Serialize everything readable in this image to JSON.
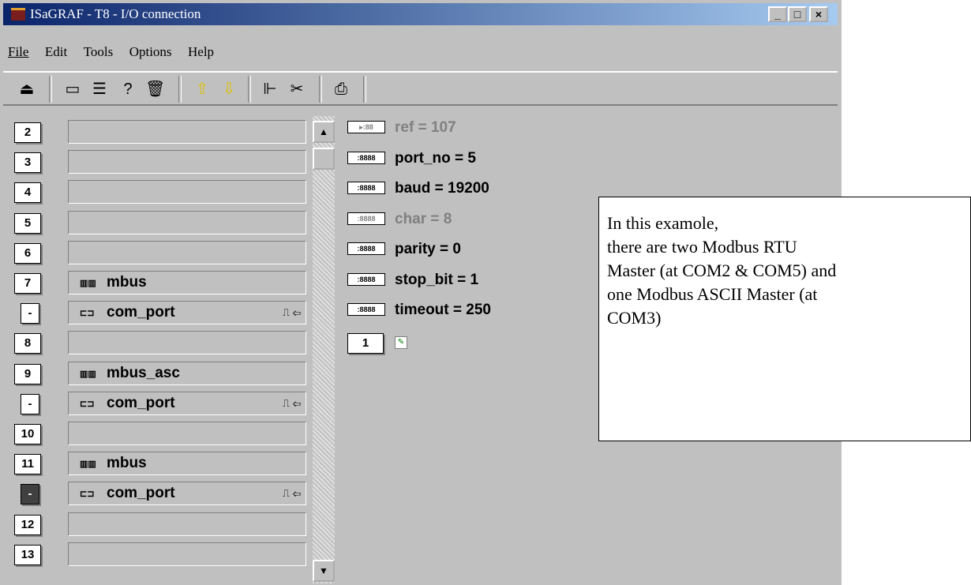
{
  "window": {
    "title": "ISaGRAF - T8 - I/O connection"
  },
  "menu": [
    "File",
    "Edit",
    "Tools",
    "Options",
    "Help"
  ],
  "slots": [
    {
      "num": "2",
      "label": ""
    },
    {
      "num": "3",
      "label": ""
    },
    {
      "num": "4",
      "label": ""
    },
    {
      "num": "5",
      "label": ""
    },
    {
      "num": "6",
      "label": ""
    },
    {
      "num": "7",
      "label": "mbus",
      "icon": "board-icon"
    },
    {
      "num": "-",
      "label": "com_port",
      "icon": "port-icon",
      "sym": "⎍ ⇦",
      "sub": true
    },
    {
      "num": "8",
      "label": ""
    },
    {
      "num": "9",
      "label": "mbus_asc",
      "icon": "board-icon"
    },
    {
      "num": "-",
      "label": "com_port",
      "icon": "port-icon",
      "sym": "⎍ ⇦",
      "sub": true
    },
    {
      "num": "10",
      "label": ""
    },
    {
      "num": "11",
      "label": "mbus",
      "icon": "board-icon"
    },
    {
      "num": "-",
      "label": "com_port",
      "icon": "port-icon",
      "sym": "⎍ ⇦",
      "sub": true,
      "selected": true
    },
    {
      "num": "12",
      "label": ""
    },
    {
      "num": "13",
      "label": ""
    }
  ],
  "params": [
    {
      "text": "ref = 107",
      "grey": true,
      "icon": "▸:88"
    },
    {
      "text": "port_no = 5",
      "grey": false,
      "icon": ":8888"
    },
    {
      "text": "baud = 19200",
      "grey": false,
      "icon": ":8888"
    },
    {
      "text": "char = 8",
      "grey": true,
      "icon": ":8888"
    },
    {
      "text": "parity = 0",
      "grey": false,
      "icon": ":8888"
    },
    {
      "text": "stop_bit = 1",
      "grey": false,
      "icon": ":8888"
    },
    {
      "text": "timeout = 250",
      "grey": false,
      "icon": ":8888"
    }
  ],
  "channel": {
    "num": "1"
  },
  "callout": {
    "lines": [
      "In this examole,",
      "there are two Modbus RTU",
      "Master (at COM2 & COM5) and",
      "one Modbus ASCII Master (at",
      "COM3)"
    ]
  }
}
